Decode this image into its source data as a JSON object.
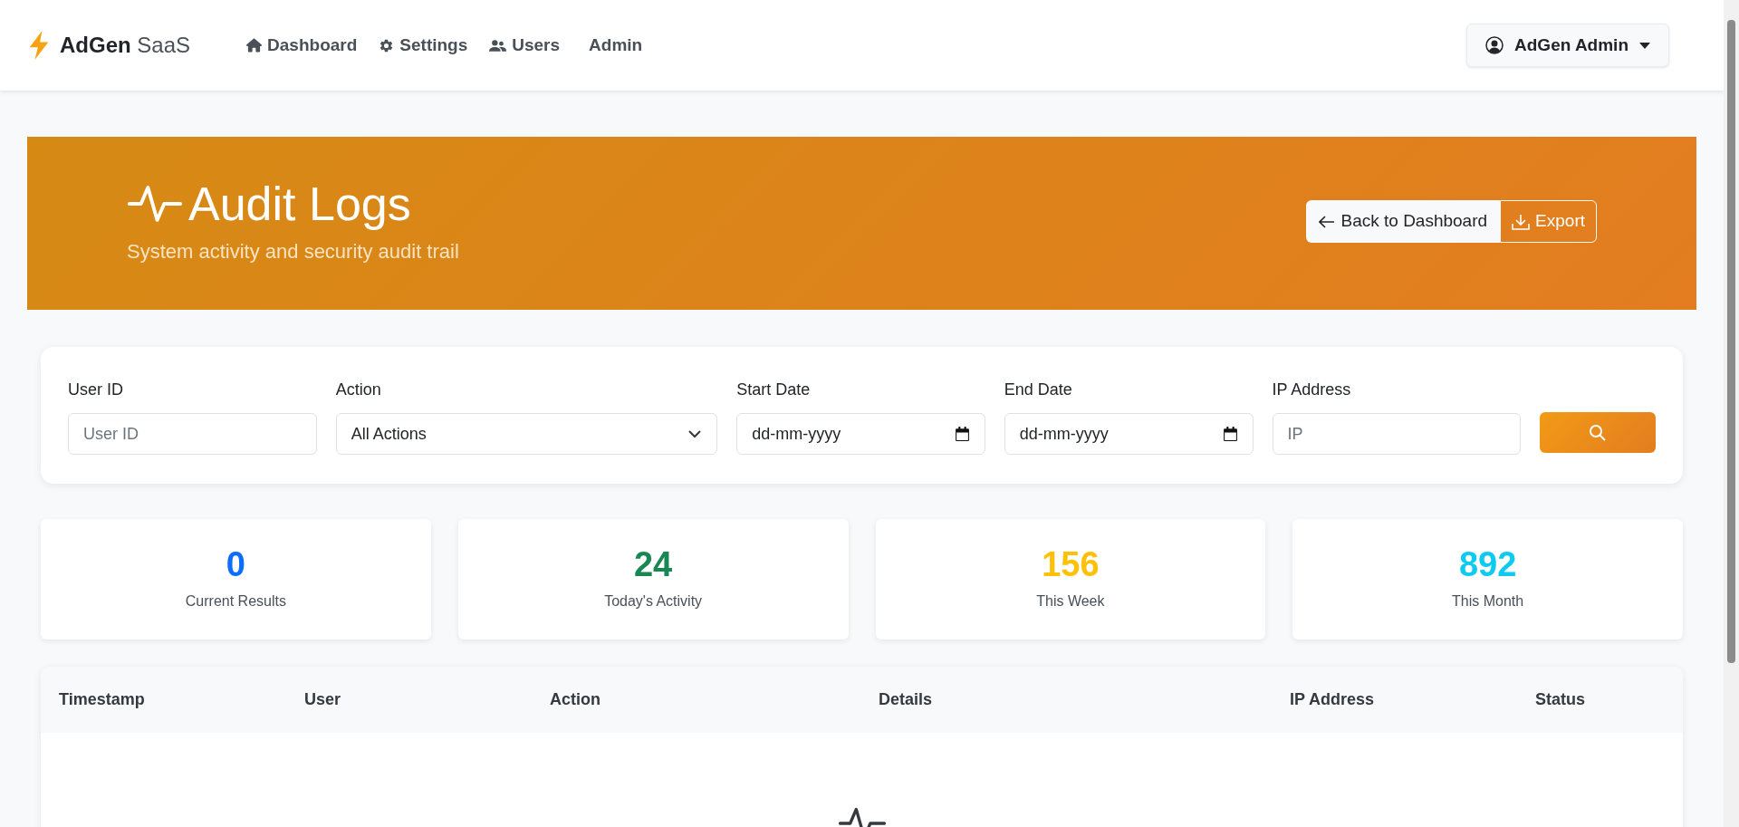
{
  "navbar": {
    "brand_bold": "AdGen",
    "brand_light": "SaaS",
    "links": [
      {
        "label": "Dashboard",
        "kind": "home"
      },
      {
        "label": "Settings",
        "kind": "gear"
      },
      {
        "label": "Users",
        "kind": "users"
      },
      {
        "label": "Admin",
        "kind": "plain"
      }
    ],
    "user_menu": "AdGen Admin"
  },
  "header": {
    "title": "Audit Logs",
    "subtitle": "System activity and security audit trail",
    "back_button": "Back to Dashboard",
    "export_button": "Export"
  },
  "filters": [
    {
      "kind": "text",
      "label": "User ID",
      "placeholder": "User ID"
    },
    {
      "kind": "select",
      "label": "Action",
      "value": "All Actions"
    },
    {
      "kind": "date",
      "label": "Start Date",
      "value": "dd-mm-yyyy"
    },
    {
      "kind": "date",
      "label": "End Date",
      "value": "dd-mm-yyyy"
    },
    {
      "kind": "text",
      "label": "IP Address",
      "placeholder": "IP"
    }
  ],
  "stats": [
    {
      "value": "0",
      "label": "Current Results",
      "color": "#0d6efd"
    },
    {
      "value": "24",
      "label": "Today's Activity",
      "color": "#198754"
    },
    {
      "value": "156",
      "label": "This Week",
      "color": "#ffc107"
    },
    {
      "value": "892",
      "label": "This Month",
      "color": "#0dcaf0"
    }
  ],
  "table": {
    "columns": [
      "Timestamp",
      "User",
      "Action",
      "Details",
      "IP Address",
      "Status"
    ]
  }
}
